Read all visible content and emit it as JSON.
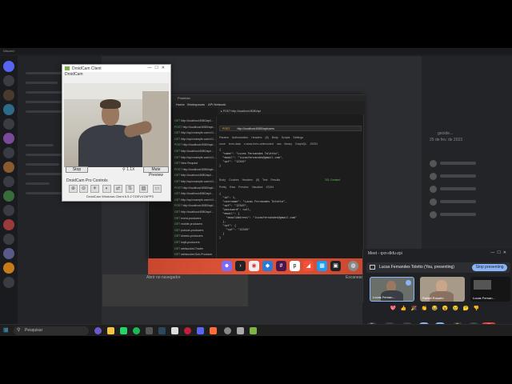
{
  "discord": {
    "topbar_label": "Discord",
    "member_header": "geoide...",
    "member_sub": "25 de fev. de 2023"
  },
  "droidcam": {
    "window_title": "DroidCam Client",
    "menu": "DroidCam",
    "stop_label": "Stop",
    "zoom_value": "1.1X",
    "mute_label": "Mute Preview",
    "pro_controls": "DroidCam Pro Controls",
    "footer": "DroidCam Windows Client 6.5.2 ©DEV47APPS"
  },
  "postman": {
    "window_title": "Postman",
    "header_items": [
      "Home",
      "Workspaces",
      "API Network"
    ],
    "url_method": "POST",
    "url": "http://localhost:8080/api/users",
    "request_tabs": [
      "Params",
      "Authorization",
      "Headers (8)",
      "Body",
      "Scripts",
      "Settings"
    ],
    "body_options": [
      "none",
      "form-data",
      "x-www-form-urlencoded",
      "raw",
      "binary",
      "GraphQL",
      "JSON"
    ],
    "request_body": [
      "{",
      "  \"name\": \"Lucas Fernandes Toletto\",",
      "  \"email\": \"lucasfernandes@gmail.com\",",
      "  \"cpf\": \"12345\"",
      "}"
    ],
    "response_tabs": [
      "Body",
      "Cookies",
      "Headers (5)",
      "Test Results"
    ],
    "response_options": [
      "Pretty",
      "Raw",
      "Preview",
      "Visualize",
      "JSON"
    ],
    "status": "201 Created",
    "response_body": [
      "{",
      "  \"id\": 1,",
      "  \"username\": \"Lucas Fernandes Toletto\",",
      "  \"cpf\": \"12345\",",
      "  \"password\": null,",
      "  \"email\": {",
      "    \"emailAddress\": \"lucasfernandes@gmail.com\"",
      "  },",
      "  \"cpf\": {",
      "    \"cpf\": \"12345\"",
      "  }",
      "}"
    ],
    "sidebar_requests": [
      {
        "method": "GET",
        "name": "http://localhost:8080/api/..."
      },
      {
        "method": "POST",
        "name": "http://localhost:8080/api/..."
      },
      {
        "method": "GET",
        "name": "http://api.example.com/v1/..."
      },
      {
        "method": "GET",
        "name": "http://api.example.com/v1/..."
      },
      {
        "method": "POST",
        "name": "http://localhost:8080/api/..."
      },
      {
        "method": "GET",
        "name": "http://localhost:8080/api/..."
      },
      {
        "method": "GET",
        "name": "http://api.example.com/v1/..."
      },
      {
        "method": "GET",
        "name": "New Request"
      },
      {
        "method": "POST",
        "name": "http://localhost:8080/api/..."
      },
      {
        "method": "GET",
        "name": "http://localhost:8080/api/..."
      },
      {
        "method": "GET",
        "name": "http://api.example.com/v1/..."
      },
      {
        "method": "POST",
        "name": "http://localhost:8080/api/..."
      },
      {
        "method": "GET",
        "name": "http://localhost:8080/api/..."
      },
      {
        "method": "GET",
        "name": "http://api.example.com/v1/..."
      },
      {
        "method": "POST",
        "name": "http://localhost:8080/api/..."
      },
      {
        "method": "GET",
        "name": "http://localhost:8080/api/..."
      },
      {
        "method": "GET",
        "name": "event-producers"
      },
      {
        "method": "GET",
        "name": "mobile-producers"
      },
      {
        "method": "GET",
        "name": "pubsub-producers"
      },
      {
        "method": "GET",
        "name": "kinesis-producers"
      },
      {
        "method": "GET",
        "name": "mqtt-producers"
      },
      {
        "method": "GET",
        "name": "websocket-Trader"
      },
      {
        "method": "GET",
        "name": "websocket-Sub-Producer"
      }
    ]
  },
  "under_dock": {
    "left_text": "Abrir no navegador",
    "right_text": "Escanear"
  },
  "meet": {
    "title": "Meet - qxn-dkfu-zpi",
    "presenting_text": "Lucas Fernandes Toletto (You, presenting)",
    "stop_label": "Stop presenting",
    "tiles": [
      {
        "name": "Lucas Fernan..."
      },
      {
        "name": "Rafael Rosario"
      },
      {
        "name": "Lucas Fernan..."
      }
    ],
    "reactions": [
      "💖",
      "👍",
      "🎉",
      "👏",
      "😂",
      "😮",
      "😢",
      "🤔",
      "👎"
    ]
  },
  "taskbar": {
    "search_placeholder": "Pesquisar"
  },
  "colors": {
    "accent": "#8ab4f8",
    "dock": "#e2553a",
    "leave_call": "#ea4335"
  }
}
